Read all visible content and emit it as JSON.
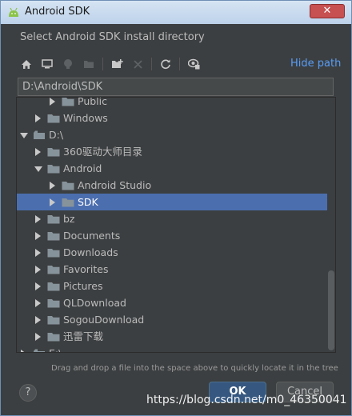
{
  "window": {
    "title": "Android SDK",
    "close_glyph": "✕"
  },
  "prompt": "Select Android SDK install directory",
  "toolbar": {
    "icons": [
      "home-icon",
      "desktop-icon",
      "project-icon",
      "module-icon",
      "new-folder-icon",
      "delete-icon",
      "refresh-icon",
      "toggle-hidden-icon"
    ],
    "hide_path_label": "Hide path"
  },
  "path_field": {
    "value": "D:\\Android\\SDK"
  },
  "tree": {
    "rows": [
      {
        "label": "Public",
        "depth": 2,
        "arrow": "right",
        "selected": false
      },
      {
        "label": "Windows",
        "depth": 1,
        "arrow": "right",
        "selected": false
      },
      {
        "label": "D:\\",
        "depth": 0,
        "arrow": "down",
        "selected": false,
        "drive": true
      },
      {
        "label": "360驱动大师目录",
        "depth": 1,
        "arrow": "right",
        "selected": false
      },
      {
        "label": "Android",
        "depth": 1,
        "arrow": "down",
        "selected": false
      },
      {
        "label": "Android Studio",
        "depth": 2,
        "arrow": "right",
        "selected": false
      },
      {
        "label": "SDK",
        "depth": 2,
        "arrow": "right",
        "selected": true
      },
      {
        "label": "bz",
        "depth": 1,
        "arrow": "right",
        "selected": false
      },
      {
        "label": "Documents",
        "depth": 1,
        "arrow": "right",
        "selected": false
      },
      {
        "label": "Downloads",
        "depth": 1,
        "arrow": "right",
        "selected": false
      },
      {
        "label": "Favorites",
        "depth": 1,
        "arrow": "right",
        "selected": false
      },
      {
        "label": "Pictures",
        "depth": 1,
        "arrow": "right",
        "selected": false
      },
      {
        "label": "QLDownload",
        "depth": 1,
        "arrow": "right",
        "selected": false
      },
      {
        "label": "SogouDownload",
        "depth": 1,
        "arrow": "right",
        "selected": false
      },
      {
        "label": "迅雷下载",
        "depth": 1,
        "arrow": "right",
        "selected": false
      },
      {
        "label": "E:\\",
        "depth": 0,
        "arrow": "right",
        "selected": false,
        "drive": true
      }
    ]
  },
  "hint": "Drag and drop a file into the space above to quickly locate it in the tree",
  "buttons": {
    "help": "?",
    "ok": "OK",
    "cancel": "Cancel"
  },
  "watermark": "https://blog.csdn.net/m0_46350041",
  "colors": {
    "selection": "#4b6eaf",
    "link": "#589df6",
    "folder": "#87939a"
  }
}
